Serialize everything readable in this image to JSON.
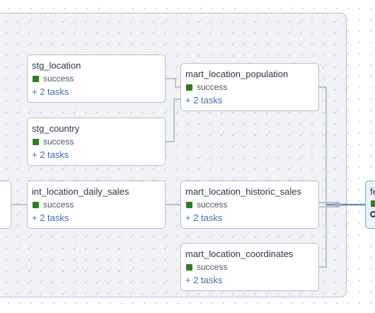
{
  "colors": {
    "success": "#2f7d1f",
    "link": "#3a6fb0",
    "selected_edge": "#5a8fc4"
  },
  "nodes": {
    "stg_location": {
      "title": "stg_location",
      "status": "success",
      "tasks": "+ 2 tasks"
    },
    "stg_country": {
      "title": "stg_country",
      "status": "success",
      "tasks": "+ 2 tasks"
    },
    "int_location_daily_sales": {
      "title": "int_location_daily_sales",
      "status": "success",
      "tasks": "+ 2 tasks"
    },
    "mart_location_population": {
      "title": "mart_location_population",
      "status": "success",
      "tasks": "+ 2 tasks"
    },
    "mart_location_historic_sales": {
      "title": "mart_location_historic_sales",
      "status": "success",
      "tasks": "+ 2 tasks"
    },
    "mart_location_coordinates": {
      "title": "mart_location_coordinates",
      "status": "success",
      "tasks": "+ 2 tasks"
    },
    "right_partial": {
      "title": "fe",
      "icon": "history-icon"
    }
  }
}
